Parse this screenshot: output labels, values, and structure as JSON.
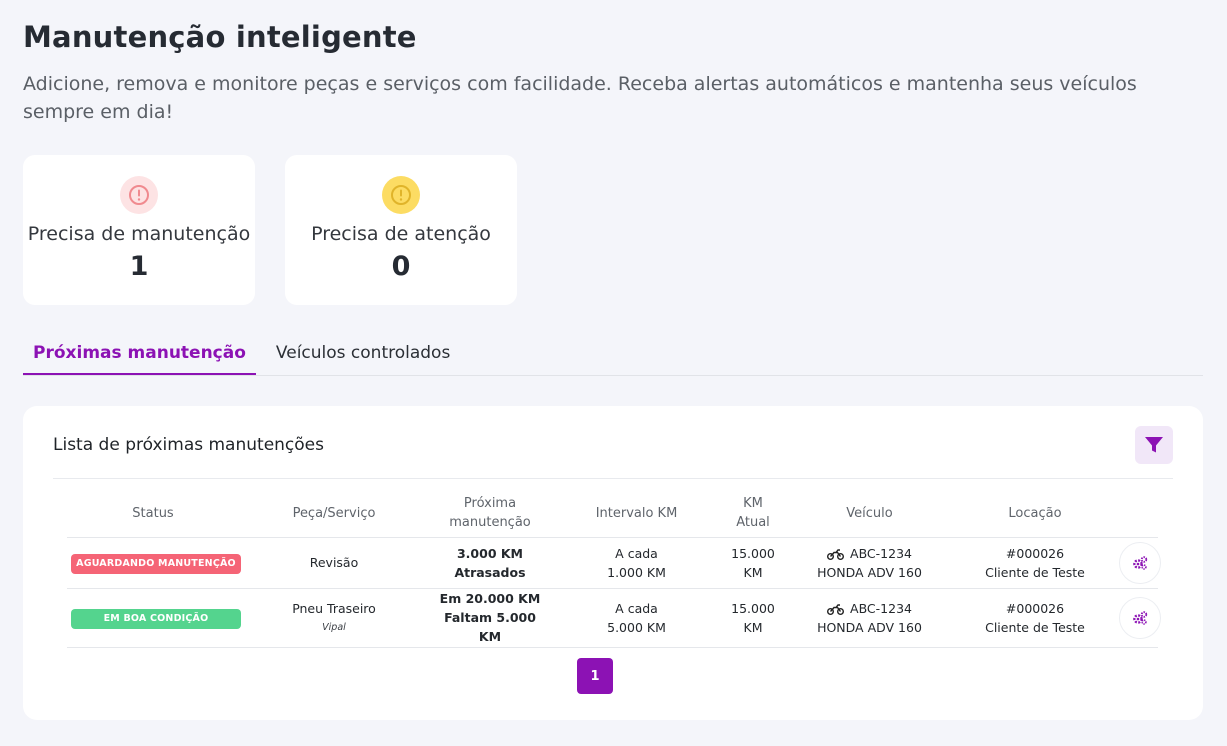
{
  "header": {
    "title": "Manutenção inteligente",
    "description": "Adicione, remova e monitore peças e serviços com facilidade. Receba alertas automáticos e mantenha seus veículos sempre em dia!"
  },
  "stats": [
    {
      "label": "Precisa de manutenção",
      "value": "1",
      "icon": "alert-circle-icon",
      "color": "#f08a8f"
    },
    {
      "label": "Precisa de atenção",
      "value": "0",
      "icon": "alert-circle-icon",
      "color": "#e8c23a"
    }
  ],
  "tabs": [
    {
      "label": "Próximas manutenção",
      "active": true
    },
    {
      "label": "Veículos controlados",
      "active": false
    }
  ],
  "list": {
    "title": "Lista de próximas manutenções",
    "filter_icon": "filter-icon",
    "columns": [
      "Status",
      "Peça/Serviço",
      "Próxima manutenção",
      "Intervalo KM",
      "KM Atual",
      "Veículo",
      "Locação"
    ],
    "rows": [
      {
        "status": "AGUARDANDO MANUTENÇÃO",
        "status_color": "#f56476",
        "part": "Revisão",
        "part_brand": "",
        "next_line1": "3.000 KM",
        "next_line2": "Atrasados",
        "interval_line1": "A cada",
        "interval_line2": "1.000 KM",
        "km_line1": "15.000",
        "km_line2": "KM",
        "vehicle_plate": "ABC-1234",
        "vehicle_model": "HONDA ADV 160",
        "rental_id": "#000026",
        "rental_client": "Cliente de Teste"
      },
      {
        "status": "EM BOA CONDIÇÃO",
        "status_color": "#54d48e",
        "part": "Pneu Traseiro",
        "part_brand": "Vipal",
        "next_line1": "Em 20.000 KM",
        "next_line2": "Faltam 5.000 KM",
        "interval_line1": "A cada",
        "interval_line2": "5.000 KM",
        "km_line1": "15.000",
        "km_line2": "KM",
        "vehicle_plate": "ABC-1234",
        "vehicle_model": "HONDA ADV 160",
        "rental_id": "#000026",
        "rental_client": "Cliente de Teste"
      }
    ]
  },
  "pagination": {
    "current_page": "1"
  },
  "colors": {
    "accent": "#8c12b4",
    "background": "#f4f5fa"
  }
}
